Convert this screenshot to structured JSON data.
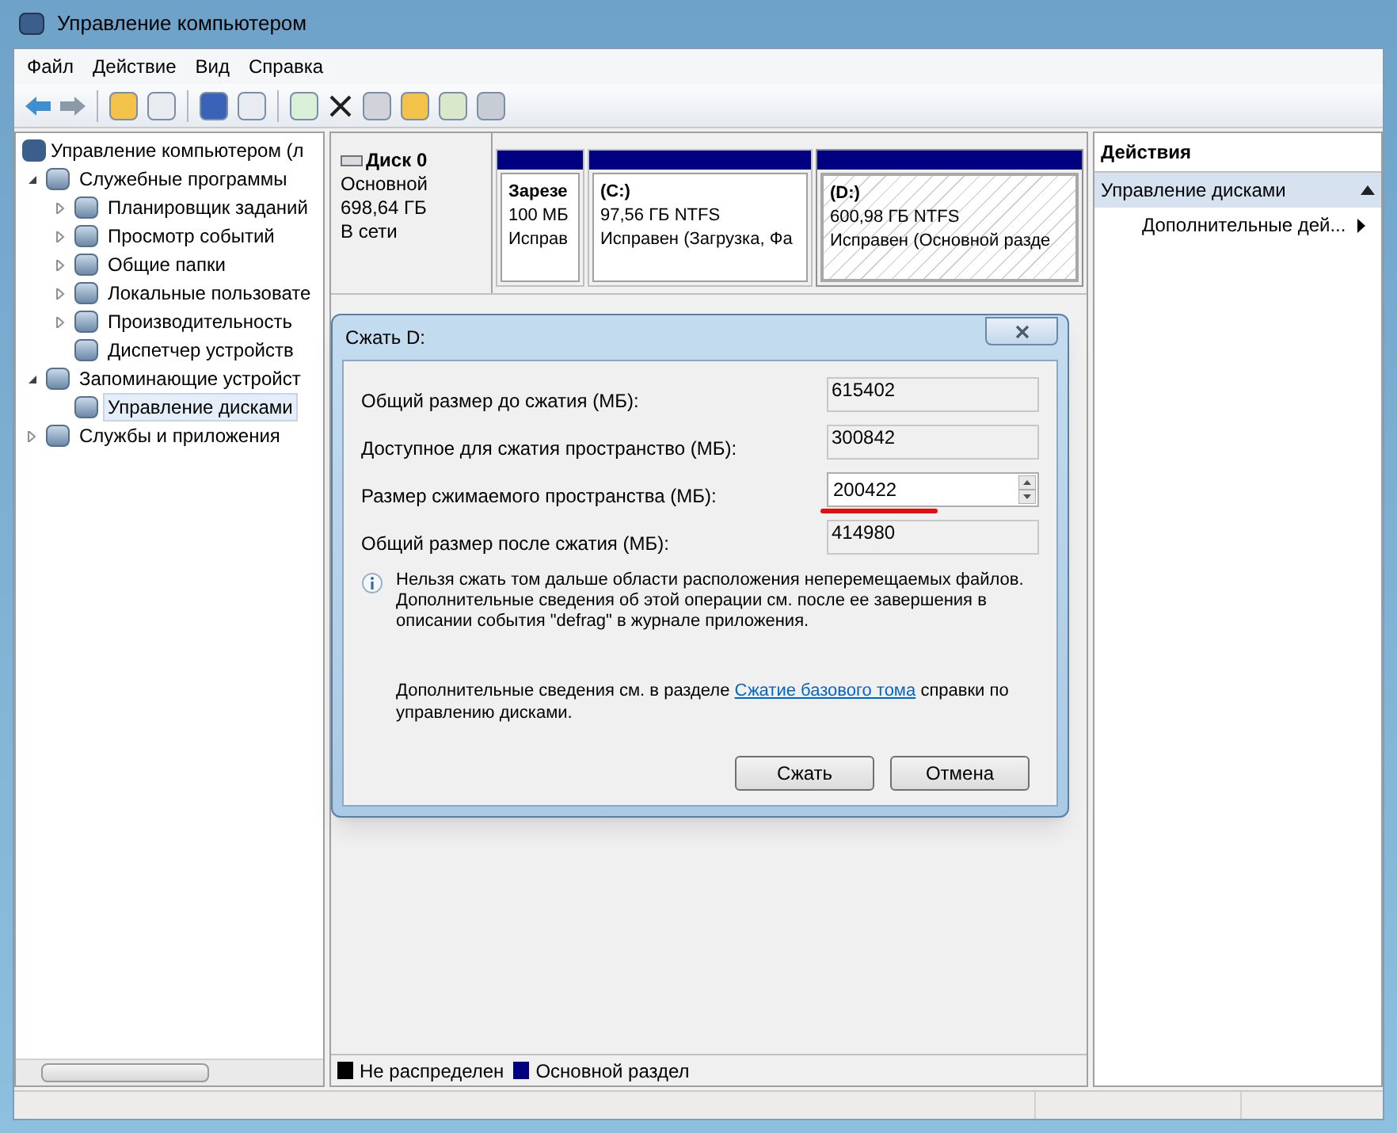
{
  "window": {
    "title": "Управление компьютером"
  },
  "menu": [
    {
      "label": "Файл"
    },
    {
      "label": "Действие"
    },
    {
      "label": "Вид"
    },
    {
      "label": "Справка"
    }
  ],
  "tree": {
    "label": "Управление компьютером (л",
    "children": [
      {
        "label": "Служебные программы",
        "expanded": true,
        "selected": false,
        "children": [
          {
            "label": "Планировщик заданий",
            "expanded": false,
            "selected": false
          },
          {
            "label": "Просмотр событий",
            "expanded": false,
            "selected": false
          },
          {
            "label": "Общие папки",
            "expanded": false,
            "selected": false
          },
          {
            "label": "Локальные пользовате",
            "expanded": false,
            "selected": false
          },
          {
            "label": "Производительность",
            "expanded": false,
            "selected": false
          },
          {
            "label": "Диспетчер устройств",
            "selected": false
          }
        ]
      },
      {
        "label": "Запоминающие устройст",
        "expanded": true,
        "selected": false,
        "children": [
          {
            "label": "Управление дисками",
            "selected": true
          }
        ]
      },
      {
        "label": "Службы и приложения",
        "expanded": false,
        "selected": false
      }
    ]
  },
  "disk": {
    "name": "Диск 0",
    "type": "Основной",
    "size": "698,64 ГБ",
    "status": "В сети",
    "partitions": [
      {
        "name": "Зарезе",
        "size": "100 МБ",
        "status": "Исправ",
        "selected": false
      },
      {
        "name": "(C:)",
        "size": "97,56 ГБ NTFS",
        "status": "Исправен (Загрузка, Фа",
        "selected": false
      },
      {
        "name": "(D:)",
        "size": "600,98 ГБ NTFS",
        "status": "Исправен (Основной разде",
        "selected": true
      }
    ]
  },
  "legend": [
    {
      "label": "Не распределен",
      "color": "#000000"
    },
    {
      "label": "Основной раздел",
      "color": "#000080"
    }
  ],
  "actions": {
    "title": "Действия",
    "section": "Управление дисками",
    "items": [
      {
        "label": "Дополнительные дей..."
      }
    ]
  },
  "dialog": {
    "title": "Сжать D:",
    "fields": [
      {
        "label": "Общий размер до сжатия (МБ):",
        "value": "615402",
        "kind": "readonly"
      },
      {
        "label": "Доступное для сжатия пространство (МБ):",
        "value": "300842",
        "kind": "readonly"
      },
      {
        "label": "Размер сжимаемого пространства (МБ):",
        "value": "200422",
        "kind": "spin"
      },
      {
        "label": "Общий размер после сжатия (МБ):",
        "value": "414980",
        "kind": "readonly"
      }
    ],
    "info": "Нельзя сжать том дальше области расположения неперемещаемых файлов. Дополнительные сведения об этой операции см. после ее завершения в описании события \"defrag\" в журнале приложения.",
    "help": {
      "before": "Дополнительные сведения см. в разделе",
      "link": "Сжатие базового тома",
      "after": "справки по управлению дисками."
    },
    "buttons": [
      {
        "label": "Сжать"
      },
      {
        "label": "Отмена"
      }
    ]
  }
}
